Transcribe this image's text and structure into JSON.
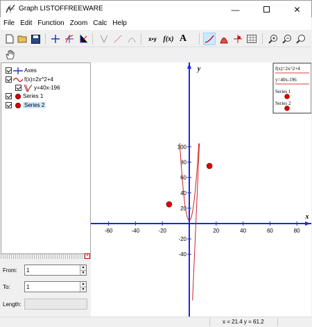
{
  "window": {
    "title": "Graph  LISTOFFREEWARE"
  },
  "menu": [
    "File",
    "Edit",
    "Function",
    "Zoom",
    "Calc",
    "Help"
  ],
  "toolbar": {
    "items": [
      {
        "name": "new-file-icon"
      },
      {
        "name": "open-folder-icon"
      },
      {
        "name": "save-icon"
      },
      {
        "name": "insert-axes-icon"
      },
      {
        "name": "insert-function-icon"
      },
      {
        "name": "insert-tangent-icon"
      },
      {
        "name": "insert-shade-icon"
      },
      {
        "name": "insert-point-series-icon"
      },
      {
        "name": "insert-trendline-icon"
      },
      {
        "name": "insert-relation-icon"
      },
      {
        "name": "insert-fx-icon"
      },
      {
        "name": "insert-label-icon"
      },
      {
        "name": "edit-function-icon"
      },
      {
        "name": "area-icon"
      },
      {
        "name": "evaluate-icon"
      },
      {
        "name": "table-icon"
      },
      {
        "name": "zoom-in-icon"
      },
      {
        "name": "zoom-out-icon"
      },
      {
        "name": "zoom-fit-icon"
      }
    ],
    "xy_label": "x•y",
    "fx_label": "f(x)",
    "text_label": "A"
  },
  "toolbar2": {
    "pan_icon": "hand-icon"
  },
  "tree": {
    "items": [
      {
        "label": "Axes"
      },
      {
        "label": "f(x)=2x^2+4"
      },
      {
        "label": "y=40x-196"
      },
      {
        "label": "Series 1"
      },
      {
        "label": "Series 2"
      }
    ]
  },
  "params": {
    "from_label": "From:",
    "from_value": "1",
    "to_label": "To:",
    "to_value": "1",
    "length_label": "Length:",
    "length_value": ""
  },
  "chart_data": {
    "type": "scatter",
    "xlim": [
      -70,
      90
    ],
    "ylim": [
      -60,
      103
    ],
    "x_ticks": [
      -60,
      -40,
      -20,
      20,
      40,
      60,
      80
    ],
    "y_ticks": [
      -40,
      -20,
      20,
      40,
      60,
      80,
      100
    ],
    "xlabel": "x",
    "ylabel": "y",
    "functions": [
      {
        "name": "f(x)=2x^2+4",
        "color": "#d02020"
      },
      {
        "name": "y=40x-196",
        "color": "#d02020"
      }
    ],
    "series": [
      {
        "name": "Series 1",
        "color": "#e00000",
        "points": [
          [
            -15,
            25
          ]
        ]
      },
      {
        "name": "Series 2",
        "color": "#e00000",
        "points": [
          [
            15,
            75
          ]
        ]
      }
    ],
    "legend": {
      "position": "top-right",
      "entries": [
        "f(x)=2x^2+4",
        "y=40x-196",
        "Series 1",
        "Series 2"
      ]
    }
  },
  "status": {
    "coords": "x = 21.4   y = 61.2"
  }
}
